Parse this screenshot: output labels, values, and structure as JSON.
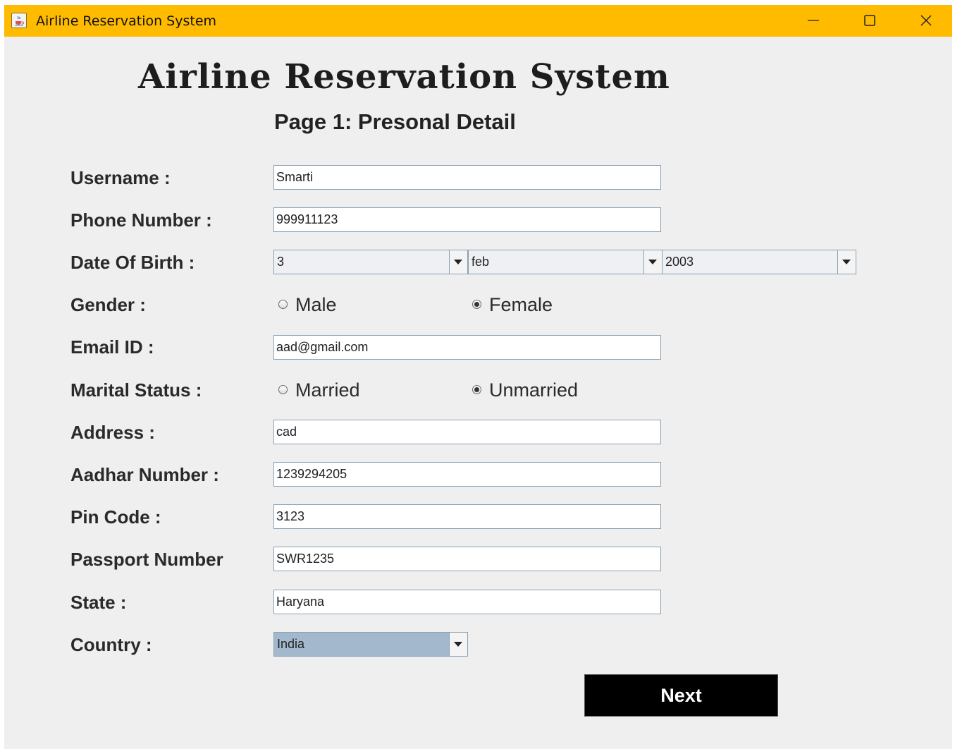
{
  "window": {
    "title": "Airline Reservation System",
    "controls": [
      "minimize-icon",
      "maximize-icon",
      "close-icon"
    ]
  },
  "colors": {
    "titlebar": "#ffbb00",
    "background": "#efefef",
    "button": "#000000",
    "combo_selected": "#a3b8cc"
  },
  "header": {
    "title": "Airline Reservation System",
    "subtitle": "Page 1: Presonal Detail"
  },
  "form": {
    "username": {
      "label": "Username :",
      "value": "Smarti"
    },
    "phone": {
      "label": "Phone Number :",
      "value": "999911123"
    },
    "dob": {
      "label": "Date Of Birth :",
      "day": "3",
      "month": "feb",
      "year": "2003"
    },
    "gender": {
      "label": "Gender :",
      "options": [
        "Male",
        "Female"
      ],
      "selected": "Female"
    },
    "email": {
      "label": "Email ID :",
      "value": "aad@gmail.com"
    },
    "marital": {
      "label": "Marital Status :",
      "options": [
        "Married",
        "Unmarried"
      ],
      "selected": "Unmarried"
    },
    "address": {
      "label": "Address :",
      "value": "cad"
    },
    "aadhar": {
      "label": "Aadhar Number :",
      "value": "1239294205"
    },
    "pincode": {
      "label": "Pin Code :",
      "value": "3123"
    },
    "passport": {
      "label": "Passport Number",
      "value": "SWR1235"
    },
    "state": {
      "label": "State :",
      "value": "Haryana"
    },
    "country": {
      "label": "Country :",
      "value": "India"
    }
  },
  "actions": {
    "next_label": "Next"
  }
}
